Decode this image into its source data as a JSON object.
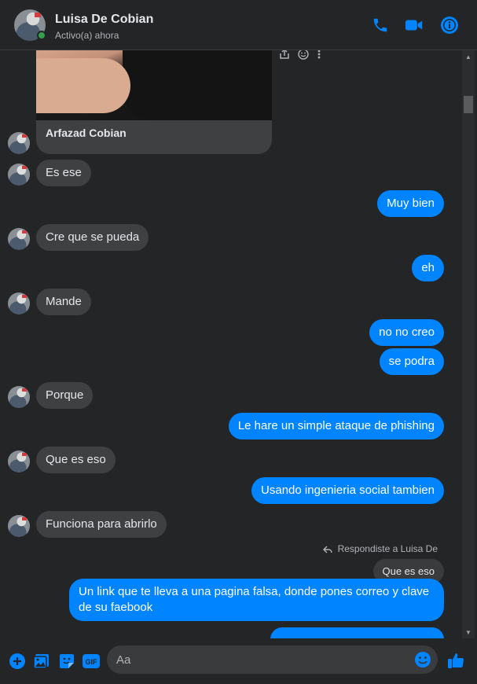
{
  "header": {
    "name": "Luisa De Cobian",
    "status": "Activo(a) ahora"
  },
  "shared_post": {
    "title": "Arfazad Cobian"
  },
  "messages": [
    {
      "dir": "in",
      "text": "Es ese"
    },
    {
      "dir": "out",
      "text": "Muy bien"
    },
    {
      "dir": "in",
      "text": "Cre que se pueda"
    },
    {
      "dir": "out",
      "text": "eh"
    },
    {
      "dir": "in",
      "text": "Mande"
    },
    {
      "dir": "out",
      "text": "no no creo"
    },
    {
      "dir": "out",
      "text": "se podra"
    },
    {
      "dir": "in",
      "text": "Porque"
    },
    {
      "dir": "out",
      "text": "Le hare un simple ataque de phishing"
    },
    {
      "dir": "in",
      "text": "Que es eso"
    },
    {
      "dir": "out",
      "text": "Usando ingenieria social tambien"
    },
    {
      "dir": "in",
      "text": "Funciona para abrirlo"
    }
  ],
  "reply": {
    "note": "Respondiste a Luisa De",
    "quoted": "Que es eso",
    "text": "Un link que te lleva a una pagina falsa, donde pones correo y clave de su faebook"
  },
  "composer": {
    "placeholder": "Aa"
  },
  "colors": {
    "accent": "#0084ff",
    "incoming_bubble": "#3e4042",
    "background": "#242526"
  },
  "icons": [
    "phone-icon",
    "video-icon",
    "info-icon",
    "plus-icon",
    "image-icon",
    "sticker-icon",
    "gif-icon",
    "emoji-icon",
    "like-icon",
    "share-icon",
    "smile-icon",
    "more-icon"
  ]
}
